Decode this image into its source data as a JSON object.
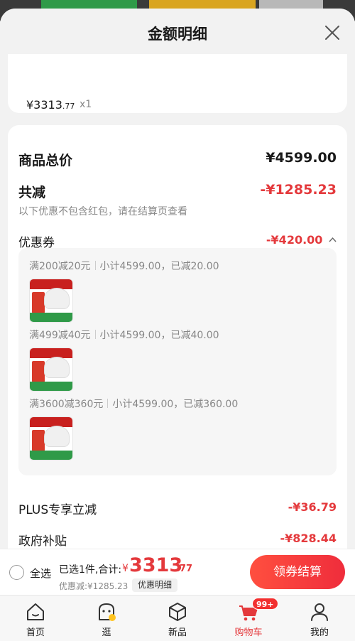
{
  "sheet": {
    "title": "金额明细",
    "item": {
      "price_main": "¥3313",
      "price_dec": ".77",
      "qty": "x1"
    }
  },
  "summary": {
    "goods_total_label": "商品总价",
    "goods_total_value": "¥4599.00",
    "total_reduction_label": "共减",
    "total_reduction_value": "-¥1285.23",
    "reduction_note": "以下优惠不包含红包，请在结算页查看",
    "coupon_label": "优惠券",
    "coupon_value": "-¥420.00",
    "coupons": [
      {
        "rule": "满200减20元",
        "detail": "小计4599.00，已减20.00"
      },
      {
        "rule": "满499减40元",
        "detail": "小计4599.00，已减40.00"
      },
      {
        "rule": "满3600减360元",
        "detail": "小计4599.00，已减360.00"
      }
    ],
    "plus_label": "PLUS专享立减",
    "plus_value": "-¥36.79",
    "subsidy_label": "政府补贴",
    "subsidy_value": "-¥828.44"
  },
  "bottom_bar": {
    "select_all": "全选",
    "selected_text": "已选1件,合计:",
    "total_symbol": "¥",
    "total_int": "3313",
    "total_dec": ".77",
    "discount_text": "优惠减:¥1285.23",
    "detail_chip": "优惠明细",
    "checkout": "领券结算"
  },
  "tabbar": {
    "tabs": [
      {
        "label": "首页",
        "icon": "home-icon"
      },
      {
        "label": "逛",
        "icon": "explore-icon"
      },
      {
        "label": "新品",
        "icon": "box-icon"
      },
      {
        "label": "购物车",
        "icon": "cart-icon",
        "badge": "99+",
        "active": true
      },
      {
        "label": "我的",
        "icon": "profile-icon"
      }
    ]
  },
  "colors": {
    "accent": "#e4393c",
    "checkout_start": "#ff4f3f",
    "checkout_end": "#ef2d3c"
  }
}
